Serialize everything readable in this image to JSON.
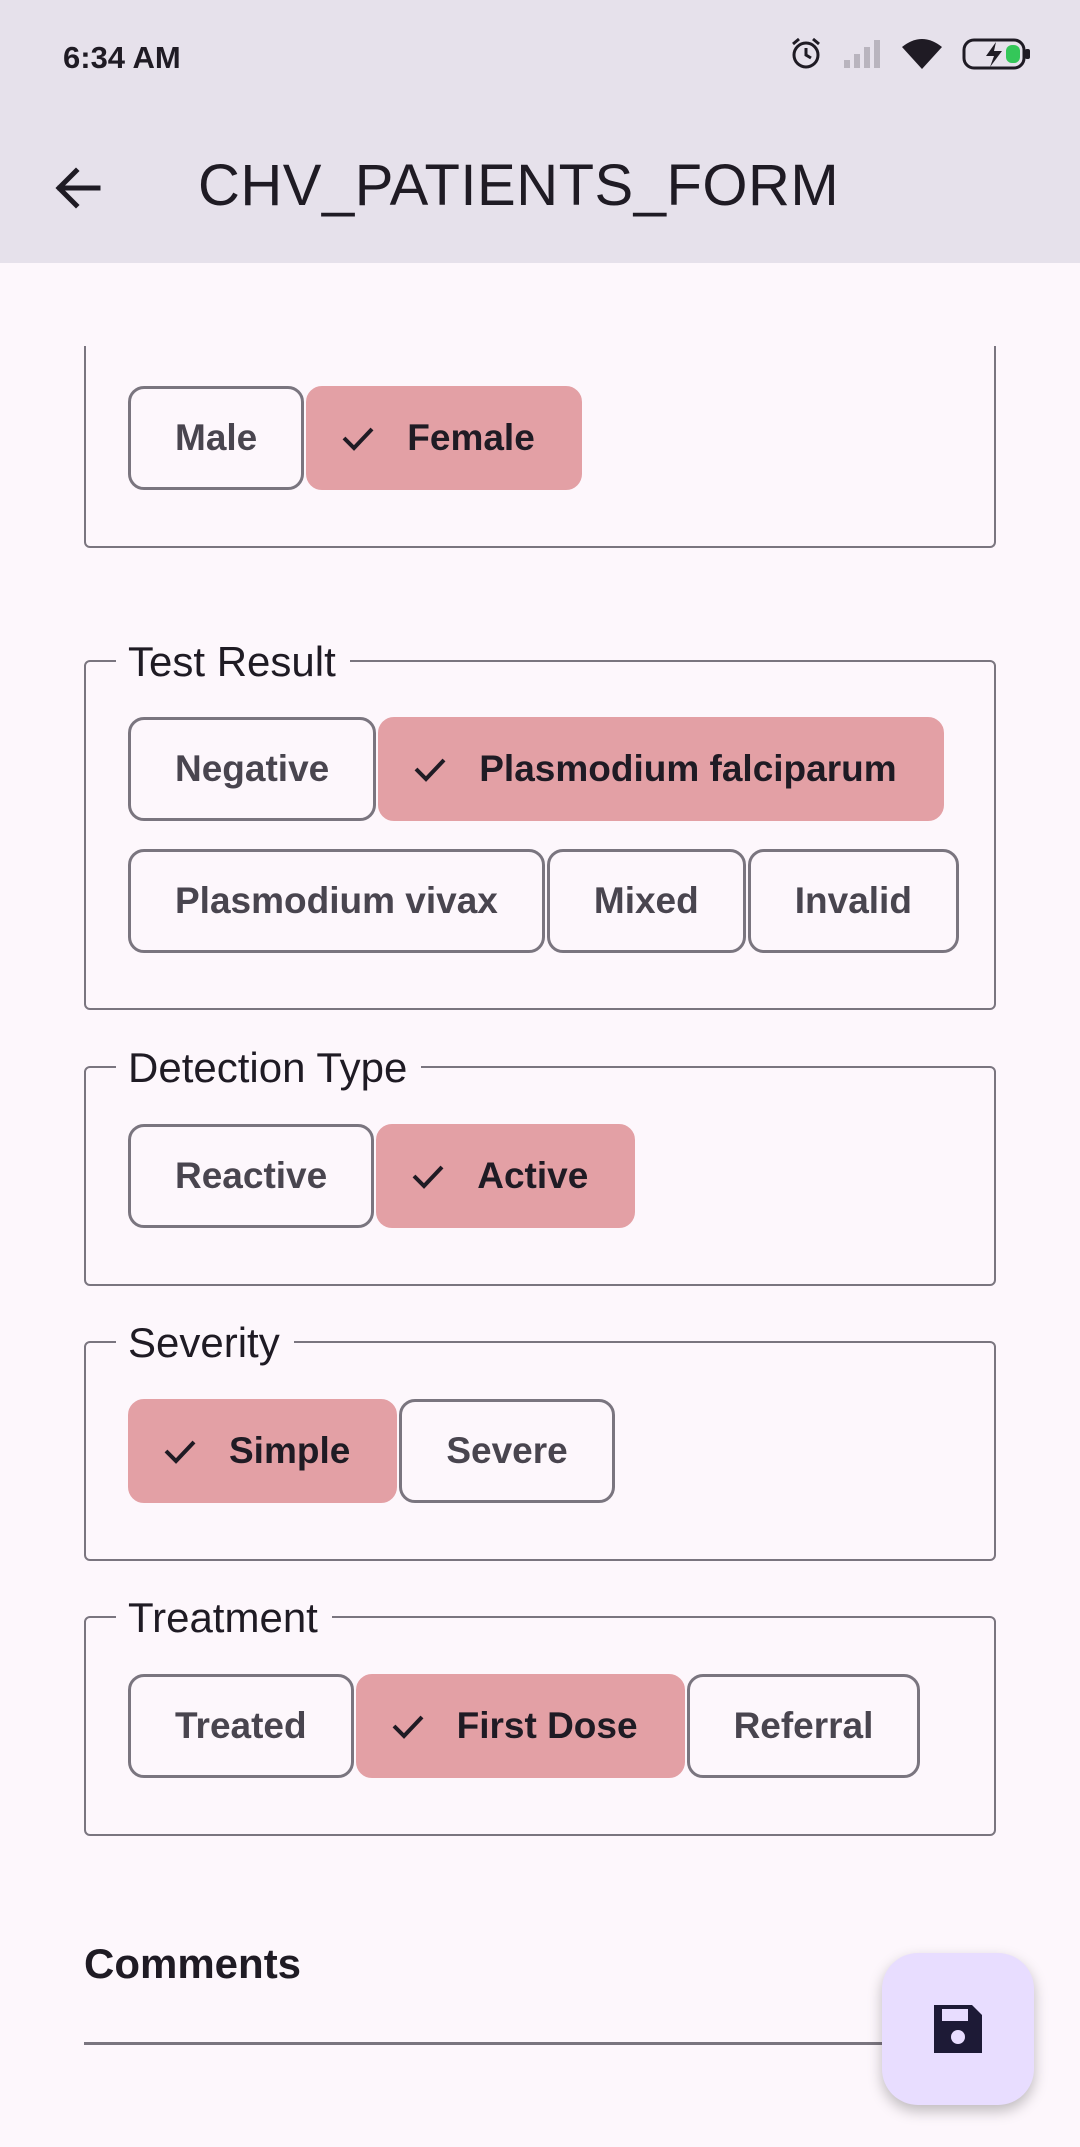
{
  "status_bar": {
    "time": "6:34 AM",
    "icons": [
      "alarm-icon",
      "signal-icon",
      "wifi-icon",
      "battery-charging-icon"
    ]
  },
  "app_bar": {
    "title": "CHV_PATIENTS_FORM",
    "back_icon": "arrow-back-icon"
  },
  "form": {
    "sex": {
      "label": "",
      "options": [
        {
          "label": "Male",
          "selected": false
        },
        {
          "label": "Female",
          "selected": true
        }
      ]
    },
    "test_result": {
      "label": "Test Result",
      "options": [
        {
          "label": "Negative",
          "selected": false
        },
        {
          "label": "Plasmodium falciparum",
          "selected": true
        },
        {
          "label": "Plasmodium vivax",
          "selected": false
        },
        {
          "label": "Mixed",
          "selected": false
        },
        {
          "label": "Invalid",
          "selected": false
        }
      ]
    },
    "detection_type": {
      "label": "Detection Type",
      "options": [
        {
          "label": "Reactive",
          "selected": false
        },
        {
          "label": "Active",
          "selected": true
        }
      ]
    },
    "severity": {
      "label": "Severity",
      "options": [
        {
          "label": "Simple",
          "selected": true
        },
        {
          "label": "Severe",
          "selected": false
        }
      ]
    },
    "treatment": {
      "label": "Treatment",
      "options": [
        {
          "label": "Treated",
          "selected": false
        },
        {
          "label": "First Dose",
          "selected": true
        },
        {
          "label": "Referral",
          "selected": false
        }
      ]
    },
    "comments": {
      "label": "Comments",
      "value": ""
    }
  },
  "fab": {
    "icon": "save-icon"
  },
  "colors": {
    "selected_chip": "#e3a0a5",
    "app_bar": "#e6e1eb",
    "background": "#fdf7fc",
    "fab": "#e8ddff"
  }
}
